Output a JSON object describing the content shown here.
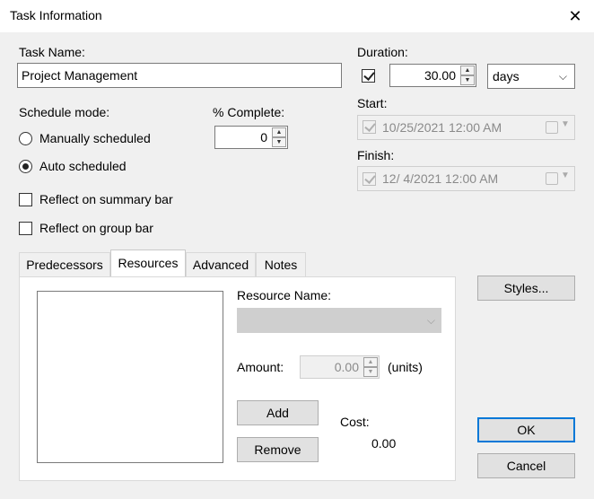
{
  "window": {
    "title": "Task Information",
    "close_symbol": "✕"
  },
  "task_name": {
    "label": "Task Name:",
    "value": "Project Management"
  },
  "duration": {
    "label": "Duration:",
    "estimated_checked": true,
    "value": "30.00",
    "unit": "days"
  },
  "schedule_mode": {
    "label": "Schedule mode:",
    "options": [
      {
        "label": "Manually scheduled",
        "selected": false
      },
      {
        "label": "Auto scheduled",
        "selected": true
      }
    ]
  },
  "percent_complete": {
    "label": "% Complete:",
    "value": "0"
  },
  "start": {
    "label": "Start:",
    "checked": true,
    "value": "10/25/2021 12:00 AM"
  },
  "finish": {
    "label": "Finish:",
    "checked": true,
    "value": "12/  4/2021 12:00 AM"
  },
  "options": {
    "reflect_summary": "Reflect on summary bar",
    "reflect_group": "Reflect on group bar"
  },
  "tabs": [
    {
      "label": "Predecessors",
      "active": false
    },
    {
      "label": "Resources",
      "active": true
    },
    {
      "label": "Advanced",
      "active": false
    },
    {
      "label": "Notes",
      "active": false
    }
  ],
  "resources": {
    "name_label": "Resource Name:",
    "amount_label": "Amount:",
    "amount_value": "0.00",
    "amount_unit": "(units)",
    "add_label": "Add",
    "remove_label": "Remove",
    "cost_label": "Cost:",
    "cost_value": "0.00"
  },
  "buttons": {
    "styles": "Styles...",
    "ok": "OK",
    "cancel": "Cancel"
  }
}
